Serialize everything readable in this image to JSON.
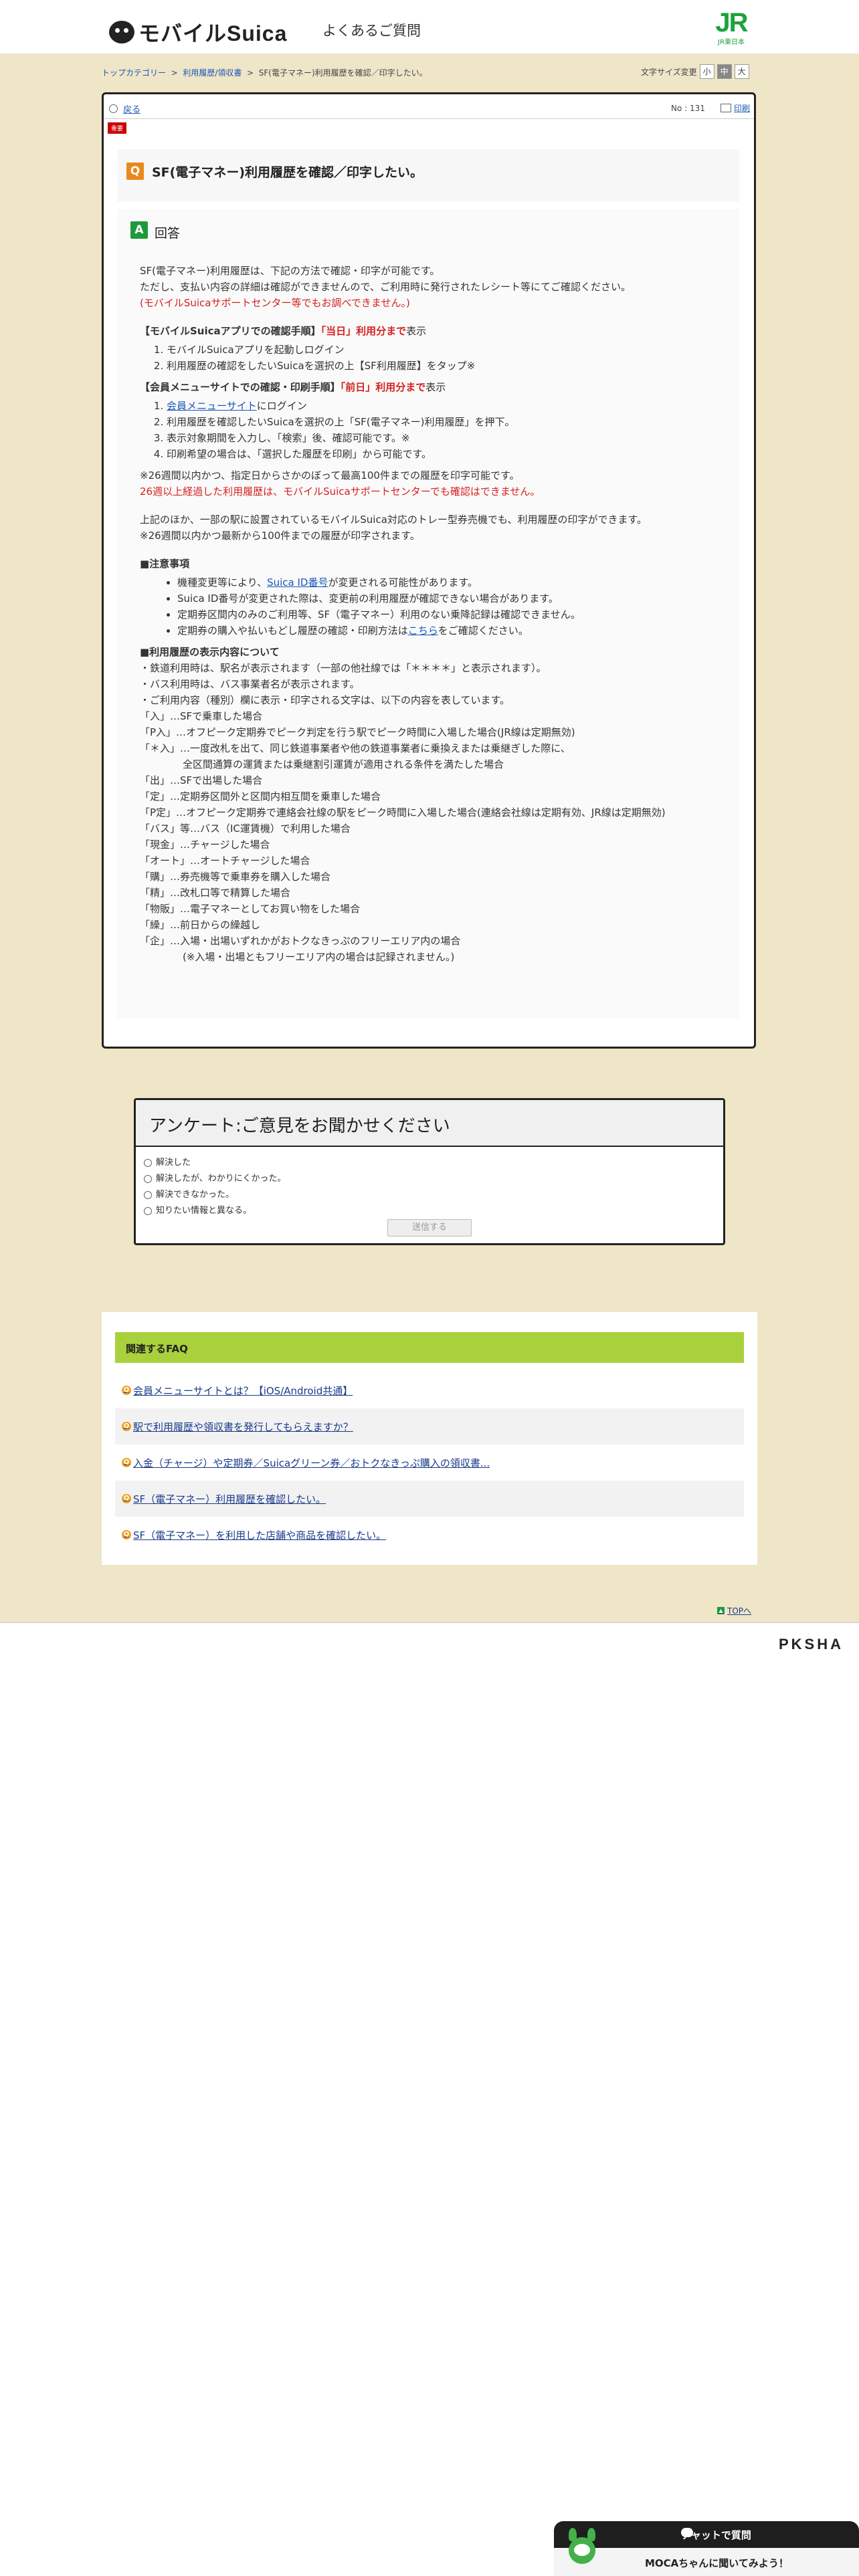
{
  "header": {
    "logo_text": "モバイルSuica",
    "title": "よくあるご質問",
    "jr_logo_mark": "JR",
    "jr_logo_sub": "JR東日本"
  },
  "breadcrumb": {
    "items": [
      "トップカテゴリー",
      "利用履歴/領収書",
      "SF(電子マネー)利用履歴を確認／印字したい。"
    ],
    "separator": ">"
  },
  "font_size": {
    "label": "文字サイズ変更",
    "options": [
      "小",
      "中",
      "大"
    ],
    "selected": "中"
  },
  "faq": {
    "back_label": "戻る",
    "number": "No : 131",
    "print_label": "印刷",
    "badge": "重要",
    "question": "SF(電子マネー)利用履歴を確認／印字したい。",
    "q_mark": "Q",
    "a_mark": "A",
    "answer_label": "回答"
  },
  "answer": {
    "intro1": "SF(電子マネー)利用履歴は、下記の方法で確認・印字が可能です。",
    "intro2": "ただし、支払い内容の詳細は確認ができませんので、ご利用時に発行されたレシート等にてご確認ください。",
    "intro3": "(モバイルSuicaサポートセンター等でもお調べできません。)",
    "app_heading_a": "【モバイルSuicaアプリでの確認手順】",
    "app_heading_b": "「当日」利用分まで",
    "app_heading_c": "表示",
    "app_steps": [
      "モバイルSuicaアプリを起動しログイン",
      "利用履歴の確認をしたいSuicaを選択の上【SF利用履歴】をタップ※"
    ],
    "web_heading_a": "【会員メニューサイトでの確認・印刷手順】",
    "web_heading_b": "「前日」利用分まで",
    "web_heading_c": "表示",
    "web_step1_link": "会員メニューサイト",
    "web_step1_rest": "にログイン",
    "web_steps": [
      "利用履歴を確認したいSuicaを選択の上「SF(電子マネー)利用履歴」を押下。",
      "表示対象期間を入力し、「検索」後、確認可能です。※",
      "印刷希望の場合は、「選択した履歴を印刷」から可能です。"
    ],
    "note1": "※26週間以内かつ、指定日からさかのぼって最高100件までの履歴を印字可能です。",
    "note2": "26週以上経過した利用履歴は、モバイルSuicaサポートセンターでも確認はできません。",
    "other1": "上記のほか、一部の駅に設置されているモバイルSuica対応のトレー型券売機でも、利用履歴の印字ができます。",
    "other2": "※26週間以内かつ最新から100件までの履歴が印字されます。",
    "caution_heading": "■注意事項",
    "caution1_a": "機種変更等により、",
    "caution1_link": "Suica ID番号",
    "caution1_b": "が変更される可能性があります。",
    "caution2": "Suica ID番号が変更された際は、変更前の利用履歴が確認できない場合があります。",
    "caution3": "定期券区間内のみのご利用等、SF（電子マネー）利用のない乗降記録は確認できません。",
    "caution4_a": "定期券の購入や払いもどし履歴の確認・印刷方法は",
    "caution4_link": "こちら",
    "caution4_b": "をご確認ください。",
    "display_heading": "■利用履歴の表示内容について",
    "display_lines": [
      "・鉄道利用時は、駅名が表示されます（一部の他社線では「＊＊＊＊」と表示されます）。",
      "・バス利用時は、バス事業者名が表示されます。",
      "・ご利用内容（種別）欄に表示・印字される文字は、以下の内容を表しています。",
      "「入」…SFで乗車した場合",
      "「P入」…オフピーク定期券でピーク判定を行う駅でピーク時間に入場した場合(JR線は定期無効)",
      "「＊入」…一度改札を出て、同じ鉄道事業者や他の鉄道事業者に乗換えまたは乗継ぎした際に、"
    ],
    "display_indent": "全区間通算の運賃または乗継割引運賃が適用される条件を満たした場合",
    "display_lines2": [
      "「出」…SFで出場した場合",
      "「定」…定期券区間外と区間内相互間を乗車した場合",
      "「P定」…オフピーク定期券で連絡会社線の駅をピーク時間に入場した場合(連絡会社線は定期有効、JR線は定期無効)",
      "「バス」等…バス（IC運賃機）で利用した場合",
      "「現金」…チャージした場合",
      "「オート」…オートチャージした場合",
      "「購」…券売機等で乗車券を購入した場合",
      "「精」…改札口等で精算した場合",
      "「物販」…電子マネーとしてお買い物をした場合",
      "「繰」…前日からの繰越し",
      "「企」…入場・出場いずれかがおトクなきっぷのフリーエリア内の場合"
    ],
    "display_last": "(※入場・出場ともフリーエリア内の場合は記録されません。)"
  },
  "survey": {
    "title": "アンケート:ご意見をお聞かせください",
    "options": [
      "解決した",
      "解決したが、わかりにくかった。",
      "解決できなかった。",
      "知りたい情報と異なる。"
    ],
    "submit_label": "送信する"
  },
  "related": {
    "heading": "関連するFAQ",
    "items": [
      "会員メニューサイトとは？【iOS/Android共通】",
      "駅で利用履歴や領収書を発行してもらえますか？",
      "入金（チャージ）や定期券／Suicaグリーン券／おトクなきっぷ購入の領収書...",
      "SF（電子マネー）利用履歴を確認したい。",
      "SF（電子マネー）を利用した店舗や商品を確認したい。"
    ]
  },
  "top_link": "TOPへ",
  "footer_brand": "PKSHA",
  "chat": {
    "title": "チャットで質問",
    "subtitle": "MOCAちゃんに聞いてみよう！"
  },
  "colors": {
    "beige_bg": "#efe5c7",
    "accent_green": "#1d9a3c",
    "related_green": "#a9d13c",
    "question_orange": "#e8891e",
    "alert_red": "#d62020"
  }
}
